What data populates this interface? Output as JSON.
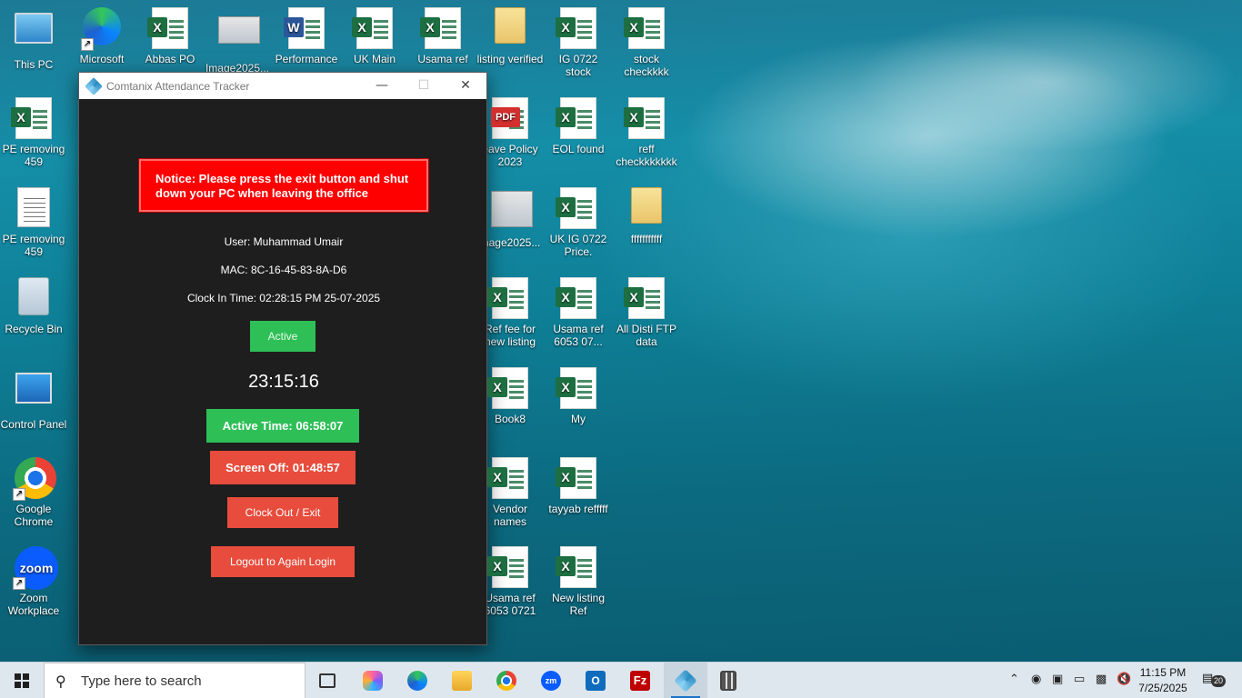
{
  "desktop_icons": [
    {
      "label": "This PC",
      "type": "pc"
    },
    {
      "label": "Microsoft Edge",
      "type": "edge"
    },
    {
      "label": "Abbas PO",
      "type": "excel"
    },
    {
      "label": "Image2025...",
      "type": "image"
    },
    {
      "label": "Performance Evaluation",
      "type": "word"
    },
    {
      "label": "UK Main Sheet",
      "type": "excel"
    },
    {
      "label": "Usama ref",
      "type": "excel"
    },
    {
      "label": "listing verified",
      "type": "folder"
    },
    {
      "label": "IG 0722 stock",
      "type": "excel"
    },
    {
      "label": "stock checkkkk",
      "type": "excel"
    },
    {
      "label": "PE removing 459",
      "type": "excel"
    },
    {
      "label": "eave Policy 2023",
      "type": "pdf"
    },
    {
      "label": "EOL found",
      "type": "excel"
    },
    {
      "label": "reff checkkkkkkk",
      "type": "excel"
    },
    {
      "label": "PE removing 459",
      "type": "document"
    },
    {
      "label": "mage2025...",
      "type": "image"
    },
    {
      "label": "UK IG 0722 Price.",
      "type": "excel"
    },
    {
      "label": "fffffffffff",
      "type": "folder"
    },
    {
      "label": "Recycle Bin",
      "type": "recycle"
    },
    {
      "label": "Ref fee for new listing",
      "type": "excel"
    },
    {
      "label": "Usama ref 6053 07...",
      "type": "excel"
    },
    {
      "label": "All Disti FTP data",
      "type": "excel"
    },
    {
      "label": "Control Panel",
      "type": "control"
    },
    {
      "label": "Book8",
      "type": "excel"
    },
    {
      "label": "My",
      "type": "excel"
    },
    {
      "label": "Google Chrome",
      "type": "chrome"
    },
    {
      "label": "Vendor names",
      "type": "excel"
    },
    {
      "label": "tayyab refffff",
      "type": "excel"
    },
    {
      "label": "Zoom Workplace",
      "type": "zoom"
    },
    {
      "label": "Usama ref 6053 0721",
      "type": "excel"
    },
    {
      "label": "New listing Ref",
      "type": "excel"
    }
  ],
  "app": {
    "title": "Comtanix Attendance Tracker",
    "notice": "Notice: Please press the exit button and shut down your PC when leaving the office",
    "user": "User: Muhammad Umair",
    "mac": "MAC: 8C-16-45-83-8A-D6",
    "clock_in": "Clock In Time: 02:28:15 PM 25-07-2025",
    "status": "Active",
    "current_time": "23:15:16",
    "active_time": "Active Time: 06:58:07",
    "screen_off": "Screen Off: 01:48:57",
    "clock_out_label": "Clock Out / Exit",
    "logout_label": "Logout to Again Login",
    "colors": {
      "green": "#2ebf57",
      "red": "#e74c3c",
      "notice_red": "#ff0000",
      "background": "#1e1e1e"
    }
  },
  "taskbar": {
    "search_placeholder": "Type here to search",
    "pinned": [
      "task-view-icon",
      "copilot-icon",
      "edge-icon",
      "file-explorer-icon",
      "chrome-icon",
      "zoom-icon",
      "outlook-icon",
      "filezilla-icon",
      "attendance-tracker-icon",
      "calculator-icon"
    ],
    "time": "11:15 PM",
    "date": "7/25/2025",
    "notification_count": "20"
  }
}
